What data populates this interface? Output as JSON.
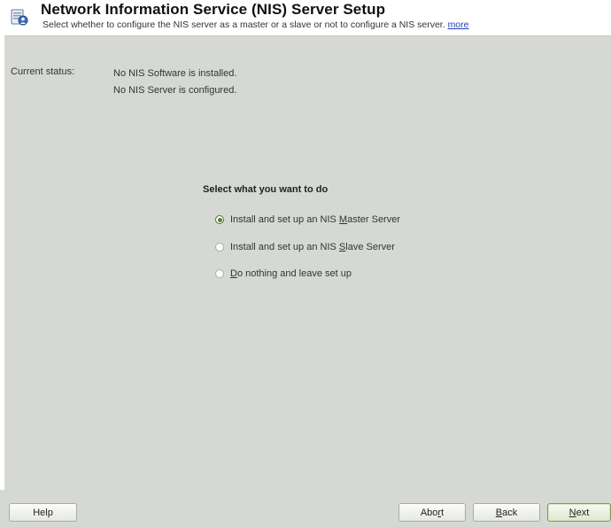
{
  "header": {
    "title": "Network Information Service (NIS) Server Setup",
    "subtitle": "Select whether to configure the NIS server as a master or a slave or not to configure a NIS server.",
    "more_link": "more"
  },
  "status": {
    "label": "Current status:",
    "lines": [
      "No NIS Software is installed.",
      "No NIS Server is configured."
    ]
  },
  "choice": {
    "title": "Select what you want to do",
    "selected_index": 0,
    "options": [
      {
        "pre": "Install and set up an NIS ",
        "mnemonic": "M",
        "post": "aster Server"
      },
      {
        "pre": "Install and set up an NIS ",
        "mnemonic": "S",
        "post": "lave Server"
      },
      {
        "pre": "",
        "mnemonic": "D",
        "post": "o nothing and leave set up"
      }
    ]
  },
  "buttons": {
    "help": "Help",
    "abort": {
      "pre": "Abo",
      "mnemonic": "r",
      "post": "t"
    },
    "back": {
      "pre": "",
      "mnemonic": "B",
      "post": "ack"
    },
    "next": {
      "pre": "",
      "mnemonic": "N",
      "post": "ext"
    }
  },
  "colors": {
    "background": "#d6d9d3",
    "link": "#1f3fb8",
    "accent_green": "#5a7f2c"
  }
}
